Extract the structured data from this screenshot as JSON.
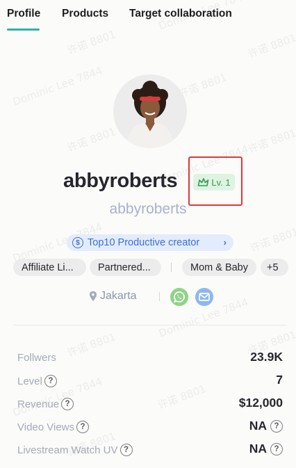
{
  "tabs": [
    {
      "label": "Profile",
      "active": true
    },
    {
      "label": "Products",
      "active": false
    },
    {
      "label": "Target collaboration",
      "active": false
    }
  ],
  "profile": {
    "username": "abbyroberts",
    "handle": "abbyroberts",
    "level": "Lv. 1",
    "badge": "Top10 Productive creator",
    "badge_icon": "dollar-circle-icon",
    "tags": [
      "Affiliate Li...",
      "Partnered...",
      "Mom & Baby",
      "+5"
    ],
    "location": "Jakarta",
    "contact_icons": [
      "whatsapp-icon",
      "mail-icon"
    ]
  },
  "stats": [
    {
      "label": "Follwers",
      "value": "23.9K",
      "label_help": false,
      "value_help": false
    },
    {
      "label": "Level",
      "value": "7",
      "label_help": true,
      "value_help": false
    },
    {
      "label": "Revenue",
      "value": "$12,000",
      "label_help": true,
      "value_help": false
    },
    {
      "label": "Video Views",
      "value": "NA",
      "label_help": true,
      "value_help": true
    },
    {
      "label": "Livestream Watch UV",
      "value": "NA",
      "label_help": true,
      "value_help": true
    }
  ],
  "watermark_texts": [
    "Dominic Lee 7844",
    "许诺 8801"
  ],
  "colors": {
    "accent": "#2db3a6",
    "level_badge_bg": "#dff3e2",
    "level_text": "#2f9c4e",
    "highlight": "#e53535",
    "productive_bg": "#e3ecfd",
    "productive_text": "#3b6fd6",
    "handle_text": "#a9b1ce"
  }
}
